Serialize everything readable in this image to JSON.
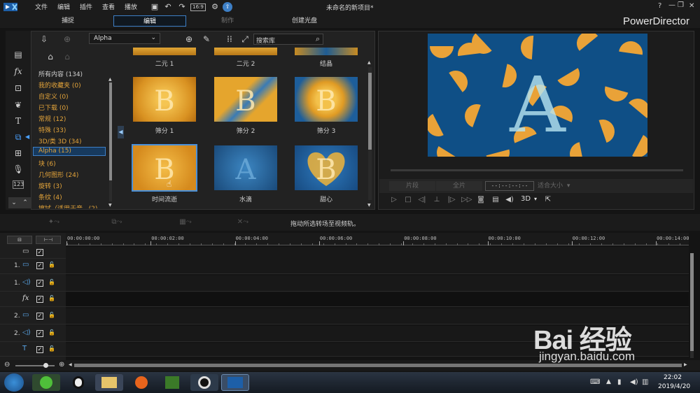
{
  "app": {
    "title": "未命名的新项目*",
    "brand": "PowerDirector",
    "menu": [
      "文件",
      "编辑",
      "插件",
      "查看",
      "播放"
    ],
    "window_controls": [
      "?",
      "—",
      "❐",
      "✕"
    ]
  },
  "modes": [
    {
      "label": "捕捉",
      "state": "normal"
    },
    {
      "label": "编辑",
      "state": "active"
    },
    {
      "label": "制作",
      "state": "dim"
    },
    {
      "label": "创建光盘",
      "state": "normal"
    }
  ],
  "library": {
    "dropdown_value": "Alpha",
    "search_placeholder": "搜索库",
    "categories": [
      {
        "label": "所有内容 (134)",
        "color": "#cfcfcf"
      },
      {
        "label": "我的收藏夹  (0)"
      },
      {
        "label": "自定义  (0)"
      },
      {
        "label": "已下载  (0)"
      },
      {
        "label": "常规  (12)"
      },
      {
        "label": "特殊  (33)"
      },
      {
        "label": "3D/类 3D  (34)"
      },
      {
        "label": "Alpha  (15)",
        "selected": true
      },
      {
        "label": "块  (6)"
      },
      {
        "label": "几何图形  (24)"
      },
      {
        "label": "旋转  (3)"
      },
      {
        "label": "条纹  (4)"
      },
      {
        "label": "擦拭（适用于音..  (2)"
      }
    ],
    "row0_labels": [
      "二元 1",
      "二元 2",
      "结晶"
    ],
    "items": [
      {
        "label": "筛分 1",
        "glyph": "B",
        "style": "dots"
      },
      {
        "label": "筛分 2",
        "glyph": "B",
        "style": "diag"
      },
      {
        "label": "筛分 3",
        "glyph": "B",
        "style": "burst"
      },
      {
        "label": "时间流逝",
        "glyph": "B",
        "style": "plain",
        "selected": true
      },
      {
        "label": "水滴",
        "glyph": "A",
        "style": "water"
      },
      {
        "label": "甜心",
        "glyph": "B",
        "style": "heart"
      }
    ]
  },
  "preview": {
    "glyph": "A",
    "buttons": [
      "片段",
      "全片"
    ],
    "timecode": "--:--:--:--",
    "fit_label": "适合大小",
    "mode_3d": "3D"
  },
  "timeline": {
    "hint": "拖动所选转场至视频轨。",
    "ruler": [
      "00:00:00:00",
      "00:00:02:00",
      "00:00:04:00",
      "00:00:06:00",
      "00:00:08:00",
      "00:00:10:00",
      "00:00:12:00",
      "00:00:14:00"
    ],
    "tracks": [
      {
        "label": "",
        "icon": "video-icon",
        "has_check": true,
        "has_lock": false
      },
      {
        "label": "1.",
        "icon": "video-icon",
        "has_check": true,
        "has_lock": true
      },
      {
        "label": "1.",
        "icon": "audio-icon",
        "has_check": true,
        "has_lock": true
      },
      {
        "label": "",
        "icon": "fx-icon",
        "has_check": true,
        "has_lock": true
      },
      {
        "label": "2.",
        "icon": "video-icon",
        "has_check": true,
        "has_lock": true
      },
      {
        "label": "2.",
        "icon": "audio-icon",
        "has_check": true,
        "has_lock": true
      },
      {
        "label": "",
        "icon": "title-icon",
        "has_check": true,
        "has_lock": true
      }
    ]
  },
  "taskbar": {
    "time": "22:02",
    "date": "2019/4/20"
  },
  "watermark": {
    "text": "Bai 经验",
    "url": "jingyan.baidu.com"
  },
  "colors": {
    "accent": "#3d7fc6",
    "category": "#e2a33a",
    "preview_bg": "#0f4f86",
    "preview_shape": "#e9a238"
  }
}
